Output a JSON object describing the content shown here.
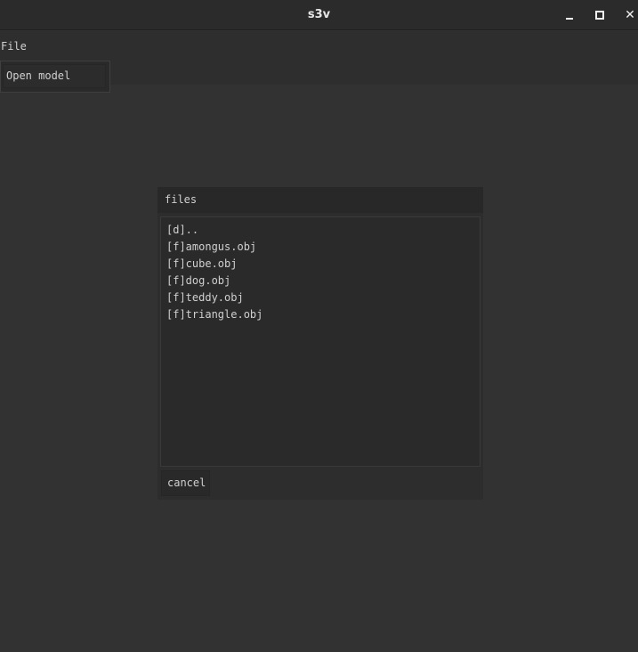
{
  "window": {
    "title": "s3v",
    "controls": {
      "minimize_icon": "minimize-icon",
      "maximize_icon": "maximize-icon",
      "close_icon": "close-icon",
      "close_glyph": "✕"
    }
  },
  "menubar": {
    "file_label": "File",
    "dropdown": {
      "items": [
        {
          "label": "Open model"
        }
      ]
    }
  },
  "files_dialog": {
    "title": "files",
    "entries": [
      {
        "label": "[d].."
      },
      {
        "label": "[f]amongus.obj"
      },
      {
        "label": "[f]cube.obj"
      },
      {
        "label": "[f]dog.obj"
      },
      {
        "label": "[f]teddy.obj"
      },
      {
        "label": "[f]triangle.obj"
      }
    ],
    "cancel_label": "cancel"
  },
  "colors": {
    "background": "#323232",
    "titlebar": "#2b2b2b",
    "panel": "#2d2d2d",
    "text": "#d0d0d0"
  }
}
